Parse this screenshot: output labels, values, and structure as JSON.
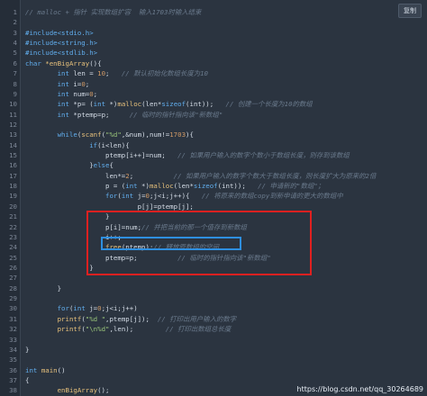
{
  "toolbar": {
    "copy_label": "复制"
  },
  "code_lines": [
    [
      {
        "t": "// malloc + 指针 实现数组扩容  输入1703时输入结束",
        "c": "cm"
      }
    ],
    [
      {
        "t": "",
        "c": "tx"
      }
    ],
    [
      {
        "t": "#include<stdio.h>",
        "c": "pp"
      }
    ],
    [
      {
        "t": "#include<string.h>",
        "c": "pp"
      }
    ],
    [
      {
        "t": "#include<stdlib.h>",
        "c": "pp"
      }
    ],
    [
      {
        "t": "char ",
        "c": "kw"
      },
      {
        "t": "*enBigArray",
        "c": "fn"
      },
      {
        "t": "(){",
        "c": "tx"
      }
    ],
    [
      {
        "t": "        ",
        "c": "tx"
      },
      {
        "t": "int",
        "c": "kw"
      },
      {
        "t": " len = ",
        "c": "tx"
      },
      {
        "t": "10",
        "c": "num"
      },
      {
        "t": ";   ",
        "c": "tx"
      },
      {
        "t": "// 默认初始化数组长度为10",
        "c": "cm"
      }
    ],
    [
      {
        "t": "        ",
        "c": "tx"
      },
      {
        "t": "int",
        "c": "kw"
      },
      {
        "t": " i=",
        "c": "tx"
      },
      {
        "t": "0",
        "c": "num"
      },
      {
        "t": ";",
        "c": "tx"
      }
    ],
    [
      {
        "t": "        ",
        "c": "tx"
      },
      {
        "t": "int",
        "c": "kw"
      },
      {
        "t": " num=",
        "c": "tx"
      },
      {
        "t": "0",
        "c": "num"
      },
      {
        "t": ";",
        "c": "tx"
      }
    ],
    [
      {
        "t": "        ",
        "c": "tx"
      },
      {
        "t": "int",
        "c": "kw"
      },
      {
        "t": " *p= (",
        "c": "tx"
      },
      {
        "t": "int",
        "c": "kw"
      },
      {
        "t": " *)",
        "c": "tx"
      },
      {
        "t": "malloc",
        "c": "fn"
      },
      {
        "t": "(len*",
        "c": "tx"
      },
      {
        "t": "sizeof",
        "c": "kw"
      },
      {
        "t": "(int));   ",
        "c": "tx"
      },
      {
        "t": "// 创建一个长度为10的数组",
        "c": "cm"
      }
    ],
    [
      {
        "t": "        ",
        "c": "tx"
      },
      {
        "t": "int",
        "c": "kw"
      },
      {
        "t": " *ptemp=p;     ",
        "c": "tx"
      },
      {
        "t": "// 临时的指针指向该\"新数组\"",
        "c": "cm"
      }
    ],
    [
      {
        "t": "",
        "c": "tx"
      }
    ],
    [
      {
        "t": "        ",
        "c": "tx"
      },
      {
        "t": "while",
        "c": "kw"
      },
      {
        "t": "(",
        "c": "tx"
      },
      {
        "t": "scanf",
        "c": "fn"
      },
      {
        "t": "(",
        "c": "tx"
      },
      {
        "t": "\"%d\"",
        "c": "str"
      },
      {
        "t": ",&num),num!=",
        "c": "tx"
      },
      {
        "t": "1703",
        "c": "num"
      },
      {
        "t": "){",
        "c": "tx"
      }
    ],
    [
      {
        "t": "                ",
        "c": "tx"
      },
      {
        "t": "if",
        "c": "kw"
      },
      {
        "t": "(i<len){",
        "c": "tx"
      }
    ],
    [
      {
        "t": "                    ptemp[i++]=num;   ",
        "c": "tx"
      },
      {
        "t": "// 如果用户输入的数字个数小于数组长度，则存到该数组",
        "c": "cm"
      }
    ],
    [
      {
        "t": "                }",
        "c": "tx"
      },
      {
        "t": "else",
        "c": "kw"
      },
      {
        "t": "{",
        "c": "tx"
      }
    ],
    [
      {
        "t": "                    len*=",
        "c": "tx"
      },
      {
        "t": "2",
        "c": "num"
      },
      {
        "t": ";          ",
        "c": "tx"
      },
      {
        "t": "// 如果用户输入的数字个数大于数组长度，则长度扩大为原来的2倍",
        "c": "cm"
      }
    ],
    [
      {
        "t": "                    p = (",
        "c": "tx"
      },
      {
        "t": "int",
        "c": "kw"
      },
      {
        "t": " *)",
        "c": "tx"
      },
      {
        "t": "malloc",
        "c": "fn"
      },
      {
        "t": "(len*",
        "c": "tx"
      },
      {
        "t": "sizeof",
        "c": "kw"
      },
      {
        "t": "(int));   ",
        "c": "tx"
      },
      {
        "t": "// 申请新的\"数组\"；",
        "c": "cm"
      }
    ],
    [
      {
        "t": "                    ",
        "c": "tx"
      },
      {
        "t": "for",
        "c": "kw"
      },
      {
        "t": "(",
        "c": "tx"
      },
      {
        "t": "int",
        "c": "kw"
      },
      {
        "t": " j=",
        "c": "tx"
      },
      {
        "t": "0",
        "c": "num"
      },
      {
        "t": ";j<i;j++){   ",
        "c": "tx"
      },
      {
        "t": "// 将原来的数组copy到新申请的更大的数组中",
        "c": "cm"
      }
    ],
    [
      {
        "t": "                            p[j]=ptemp[j];",
        "c": "tx"
      }
    ],
    [
      {
        "t": "                    }",
        "c": "tx"
      }
    ],
    [
      {
        "t": "                    p[i]=num;",
        "c": "tx"
      },
      {
        "t": "// 并把当前的那一个值存到新数组",
        "c": "cm"
      }
    ],
    [
      {
        "t": "                    i++;",
        "c": "tx"
      }
    ],
    [
      {
        "t": "                    ",
        "c": "tx"
      },
      {
        "t": "free",
        "c": "fn"
      },
      {
        "t": "(ptemp);",
        "c": "tx"
      },
      {
        "t": "// 释放原数组的空间",
        "c": "cm"
      }
    ],
    [
      {
        "t": "                    ptemp=p;          ",
        "c": "tx"
      },
      {
        "t": "// 临时的指针指向该\"新数组\"",
        "c": "cm"
      }
    ],
    [
      {
        "t": "                }",
        "c": "tx"
      }
    ],
    [
      {
        "t": "",
        "c": "tx"
      }
    ],
    [
      {
        "t": "        }",
        "c": "tx"
      }
    ],
    [
      {
        "t": "",
        "c": "tx"
      }
    ],
    [
      {
        "t": "        ",
        "c": "tx"
      },
      {
        "t": "for",
        "c": "kw"
      },
      {
        "t": "(",
        "c": "tx"
      },
      {
        "t": "int",
        "c": "kw"
      },
      {
        "t": " j=",
        "c": "tx"
      },
      {
        "t": "0",
        "c": "num"
      },
      {
        "t": ";j<i;j++)",
        "c": "tx"
      }
    ],
    [
      {
        "t": "        ",
        "c": "tx"
      },
      {
        "t": "printf",
        "c": "fn"
      },
      {
        "t": "(",
        "c": "tx"
      },
      {
        "t": "\"%d \"",
        "c": "str"
      },
      {
        "t": ",ptemp[j]);  ",
        "c": "tx"
      },
      {
        "t": "// 打印出用户输入的数字",
        "c": "cm"
      }
    ],
    [
      {
        "t": "        ",
        "c": "tx"
      },
      {
        "t": "printf",
        "c": "fn"
      },
      {
        "t": "(",
        "c": "tx"
      },
      {
        "t": "\"\\n%d\"",
        "c": "str"
      },
      {
        "t": ",len);        ",
        "c": "tx"
      },
      {
        "t": "// 打印出数组总长度",
        "c": "cm"
      }
    ],
    [
      {
        "t": "",
        "c": "tx"
      }
    ],
    [
      {
        "t": "}",
        "c": "tx"
      }
    ],
    [
      {
        "t": "",
        "c": "tx"
      }
    ],
    [
      {
        "t": "int",
        "c": "kw"
      },
      {
        "t": " ",
        "c": "tx"
      },
      {
        "t": "main",
        "c": "fn"
      },
      {
        "t": "()",
        "c": "tx"
      }
    ],
    [
      {
        "t": "{",
        "c": "tx"
      }
    ],
    [
      {
        "t": "        ",
        "c": "tx"
      },
      {
        "t": "enBigArray",
        "c": "fn"
      },
      {
        "t": "();",
        "c": "tx"
      }
    ],
    [
      {
        "t": "}",
        "c": "tx"
      }
    ]
  ],
  "watermark": "https://blog.csdn.net/qq_30264689"
}
